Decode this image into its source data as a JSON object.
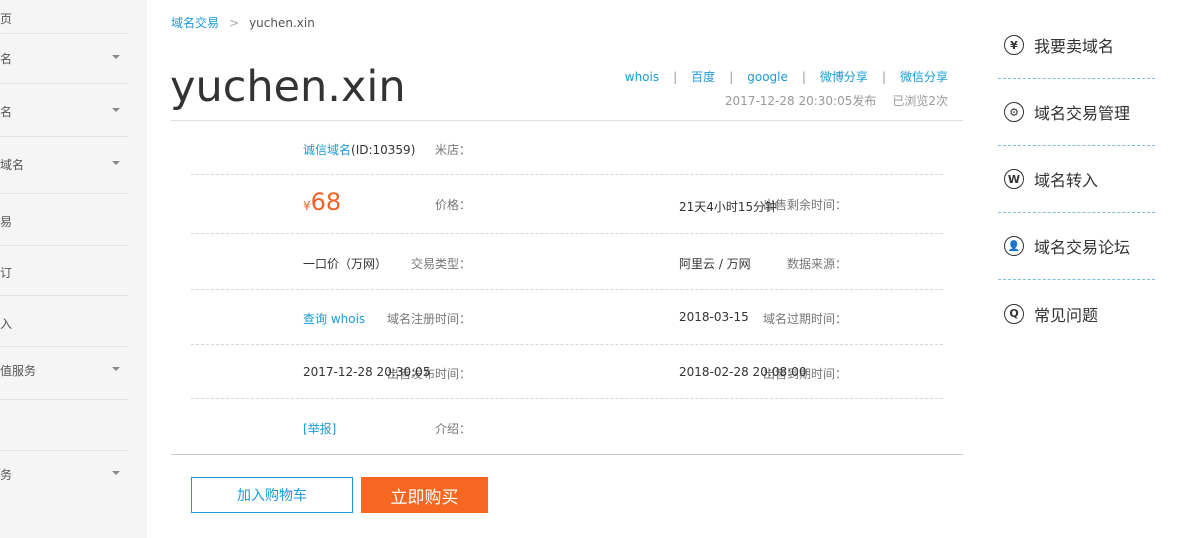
{
  "sidebar": {
    "items": [
      {
        "label": "页",
        "caret": false
      },
      {
        "label": "名",
        "caret": true
      },
      {
        "label": "名",
        "caret": true
      },
      {
        "label": "域名",
        "caret": true
      },
      {
        "label": "易",
        "caret": false
      },
      {
        "label": "订",
        "caret": false
      },
      {
        "label": "入",
        "caret": false
      },
      {
        "label": "值服务",
        "caret": true
      },
      {
        "label": "",
        "caret": false
      },
      {
        "label": "务",
        "caret": true
      }
    ]
  },
  "breadcrumb": {
    "parent": "域名交易",
    "separator": ">",
    "current": "yuchen.xin"
  },
  "domain": "yuchen.xin",
  "share": {
    "links": [
      "whois",
      "百度",
      "google",
      "微博分享",
      "微信分享"
    ],
    "divider": "|",
    "published": "2017-12-28 20:30:05发布",
    "views": "已浏览2次"
  },
  "details": {
    "shop_label": "米店：",
    "shop_name": "诚信域名",
    "shop_id": "(ID:10359)",
    "price_label": "价格：",
    "price_symbol": "¥",
    "price_value": "68",
    "remain_label": "出售剩余时间：",
    "remain_value": "21天4小时15分钟",
    "type_label": "交易类型：",
    "type_value": "一口价（万网）",
    "source_label": "数据来源：",
    "source_value": "阿里云 / 万网",
    "reg_label": "域名注册时间：",
    "reg_value": "查询 whois",
    "expire_label": "域名过期时间：",
    "expire_value": "2018-03-15",
    "publish_label": "出售发布时间：",
    "publish_value": "2017-12-28 20:30:05",
    "due_label": "出售到期时间：",
    "due_value": "2018-02-28 20:08:00",
    "intro_label": "介绍：",
    "intro_value": "[举报]"
  },
  "actions": {
    "cart": "加入购物车",
    "buy": "立即购买"
  },
  "right_menu": [
    {
      "icon": "¥",
      "label": "我要卖域名"
    },
    {
      "icon": "⚙",
      "label": "域名交易管理"
    },
    {
      "icon": "W",
      "label": "域名转入"
    },
    {
      "icon": "👤",
      "label": "域名交易论坛"
    },
    {
      "icon": "Q",
      "label": "常见问题"
    }
  ],
  "colors": {
    "link": "#1a9bd7",
    "price": "#f0632a",
    "buy_button": "#f86722"
  }
}
